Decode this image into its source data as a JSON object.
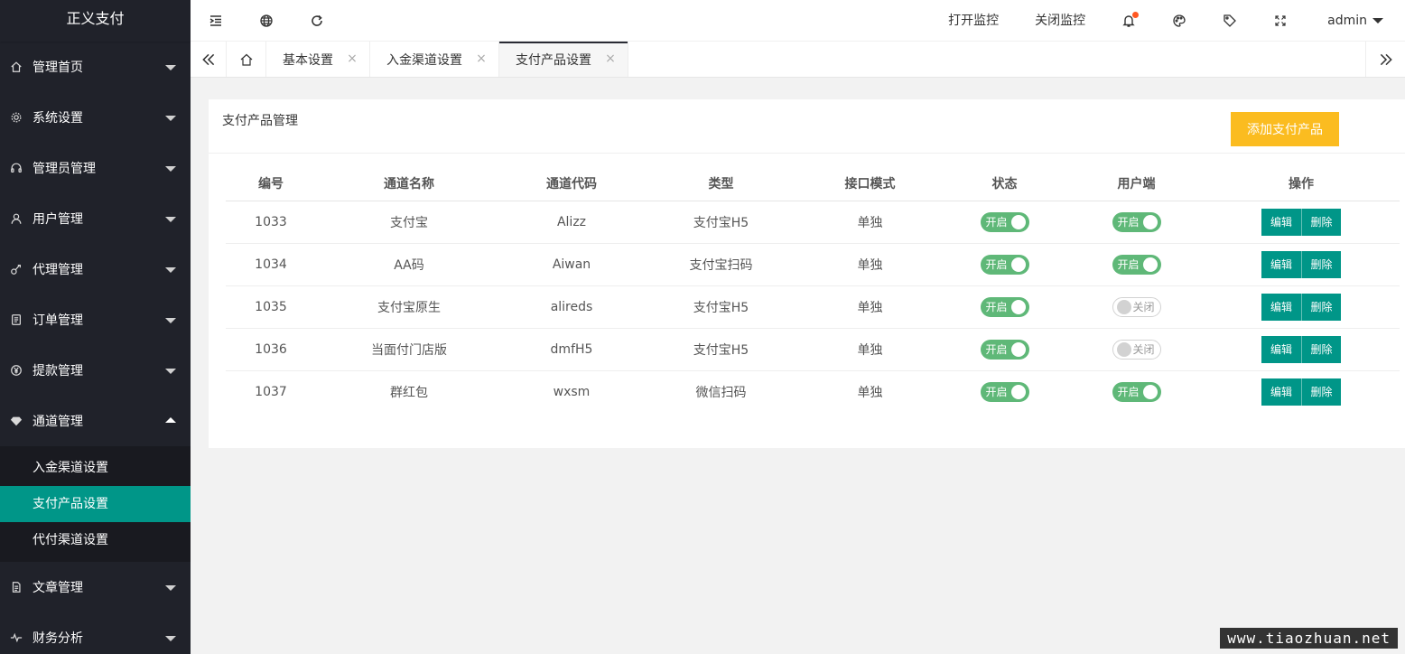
{
  "app": {
    "logo": "正义支付"
  },
  "sidebar": {
    "items": [
      {
        "label": "管理首页",
        "icon": "home-icon"
      },
      {
        "label": "系统设置",
        "icon": "gear-icon"
      },
      {
        "label": "管理员管理",
        "icon": "headset-icon"
      },
      {
        "label": "用户管理",
        "icon": "user-icon"
      },
      {
        "label": "代理管理",
        "icon": "agent-icon"
      },
      {
        "label": "订单管理",
        "icon": "order-icon"
      },
      {
        "label": "提款管理",
        "icon": "yen-icon"
      },
      {
        "label": "通道管理",
        "icon": "diamond-icon",
        "expanded": true
      }
    ],
    "subitems": [
      {
        "label": "入金渠道设置"
      },
      {
        "label": "支付产品设置",
        "active": true
      },
      {
        "label": "代付渠道设置"
      }
    ],
    "items_after": [
      {
        "label": "文章管理",
        "icon": "doc-icon"
      },
      {
        "label": "财务分析",
        "icon": "pulse-icon"
      }
    ]
  },
  "header": {
    "open_monitor": "打开监控",
    "close_monitor": "关闭监控",
    "user": "admin"
  },
  "tabs": [
    {
      "label": "基本设置"
    },
    {
      "label": "入金渠道设置"
    },
    {
      "label": "支付产品设置",
      "active": true
    }
  ],
  "card": {
    "title": "支付产品管理",
    "add_button": "添加支付产品"
  },
  "table": {
    "headers": [
      "编号",
      "通道名称",
      "通道代码",
      "类型",
      "接口模式",
      "状态",
      "用户端",
      "操作"
    ],
    "rows": [
      {
        "id": "1033",
        "name": "支付宝",
        "code": "Alizz",
        "type": "支付宝H5",
        "mode": "单独",
        "status": "开启",
        "client": "开启"
      },
      {
        "id": "1034",
        "name": "AA码",
        "code": "Aiwan",
        "type": "支付宝扫码",
        "mode": "单独",
        "status": "开启",
        "client": "开启"
      },
      {
        "id": "1035",
        "name": "支付宝原生",
        "code": "alireds",
        "type": "支付宝H5",
        "mode": "单独",
        "status": "开启",
        "client": "关闭"
      },
      {
        "id": "1036",
        "name": "当面付门店版",
        "code": "dmfH5",
        "type": "支付宝H5",
        "mode": "单独",
        "status": "开启",
        "client": "关闭"
      },
      {
        "id": "1037",
        "name": "群红包",
        "code": "wxsm",
        "type": "微信扫码",
        "mode": "单独",
        "status": "开启",
        "client": "开启"
      }
    ],
    "edit_label": "编辑",
    "delete_label": "删除"
  },
  "watermark": "www.tiaozhuan.net",
  "colors": {
    "sidebar_bg": "#20222a",
    "active": "#009688",
    "switch_on": "#5fb878",
    "add_button": "#fbbc20",
    "notify_dot": "#ff5722"
  }
}
